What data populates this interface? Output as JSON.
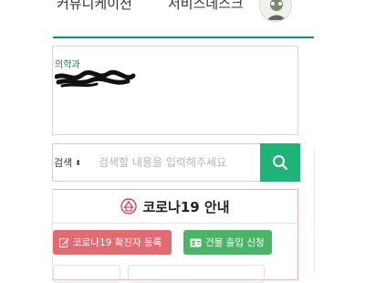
{
  "nav": {
    "items": [
      "커뮤니케이션",
      "서비스데스크"
    ]
  },
  "profile": {
    "department": "의학과"
  },
  "search": {
    "select_value": "검색",
    "placeholder": "검색할 내용을 입력해주세요"
  },
  "covid": {
    "title": "코로나19 안내",
    "register_button": "코로나19 확진자 등록",
    "entry_button": "건물 출입 신청"
  },
  "colors": {
    "accent": "#1fb37a",
    "nav_underline": "#0f8f7b",
    "danger_button": "#e36b6f",
    "success_button": "#4bb466"
  },
  "icons": [
    "avatar-icon",
    "search-icon",
    "covid-info-icon",
    "edit-icon",
    "id-card-icon",
    "sort-arrows-icon"
  ]
}
